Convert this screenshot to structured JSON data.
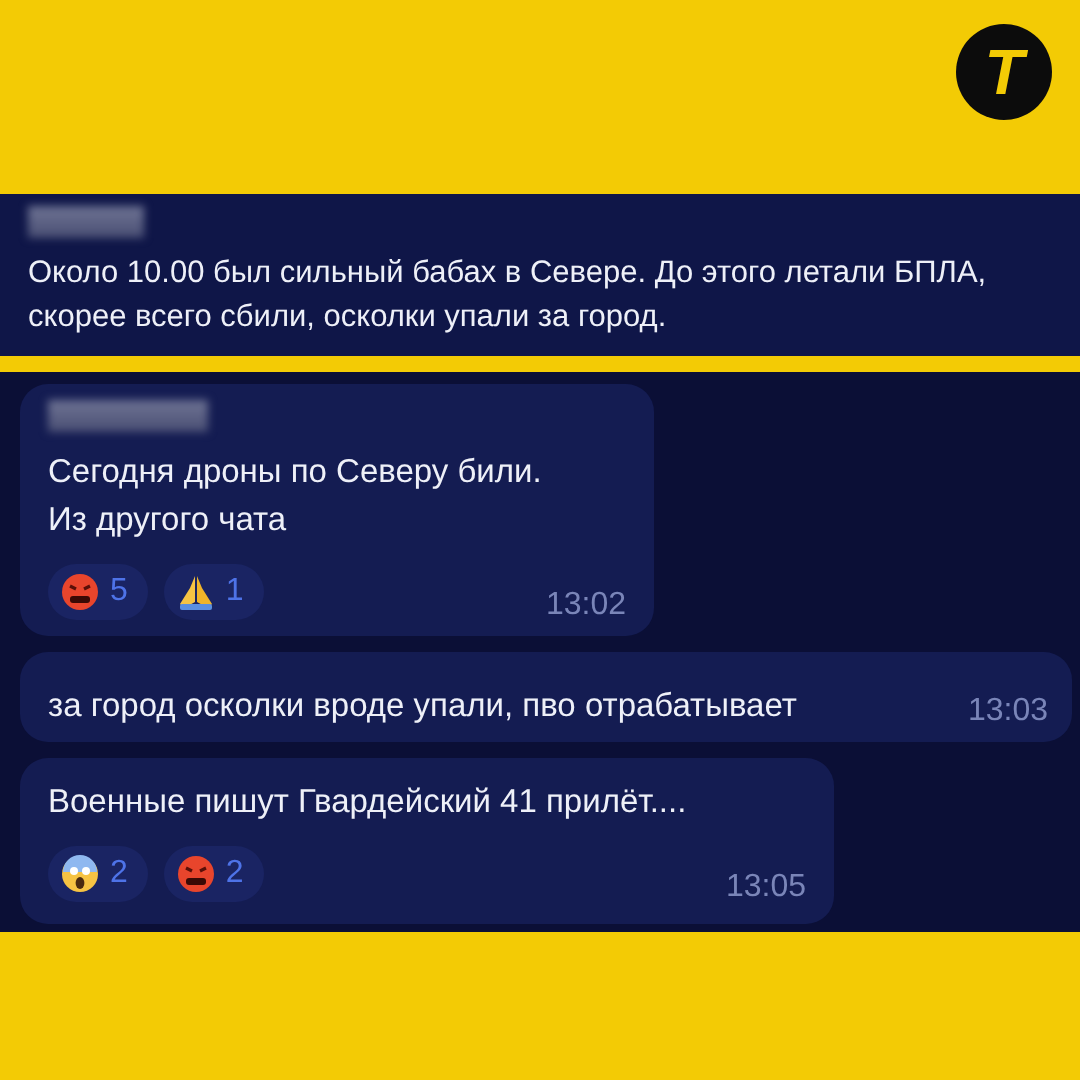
{
  "logo": {
    "letter": "T"
  },
  "quoted": {
    "name_blurred": true,
    "text": "Около 10.00 был сильный бабах в Севере. До этого летали БПЛА, скорее всего сбили, осколки упали за город."
  },
  "messages": [
    {
      "name_blurred": true,
      "lines": [
        "Сегодня дроны по Северу били.",
        "Из другого чата"
      ],
      "reactions": [
        {
          "kind": "angry",
          "count": "5"
        },
        {
          "kind": "pray",
          "count": "1"
        }
      ],
      "time": "13:02"
    },
    {
      "name_blurred": false,
      "lines": [
        "за город осколки вроде упали, пво отрабатывает"
      ],
      "time": "13:03"
    },
    {
      "name_blurred": false,
      "lines": [
        "Военные пишут Гвардейский 41 прилёт...."
      ],
      "reactions": [
        {
          "kind": "scream",
          "count": "2"
        },
        {
          "kind": "angry",
          "count": "2"
        }
      ],
      "time": "13:05"
    }
  ]
}
